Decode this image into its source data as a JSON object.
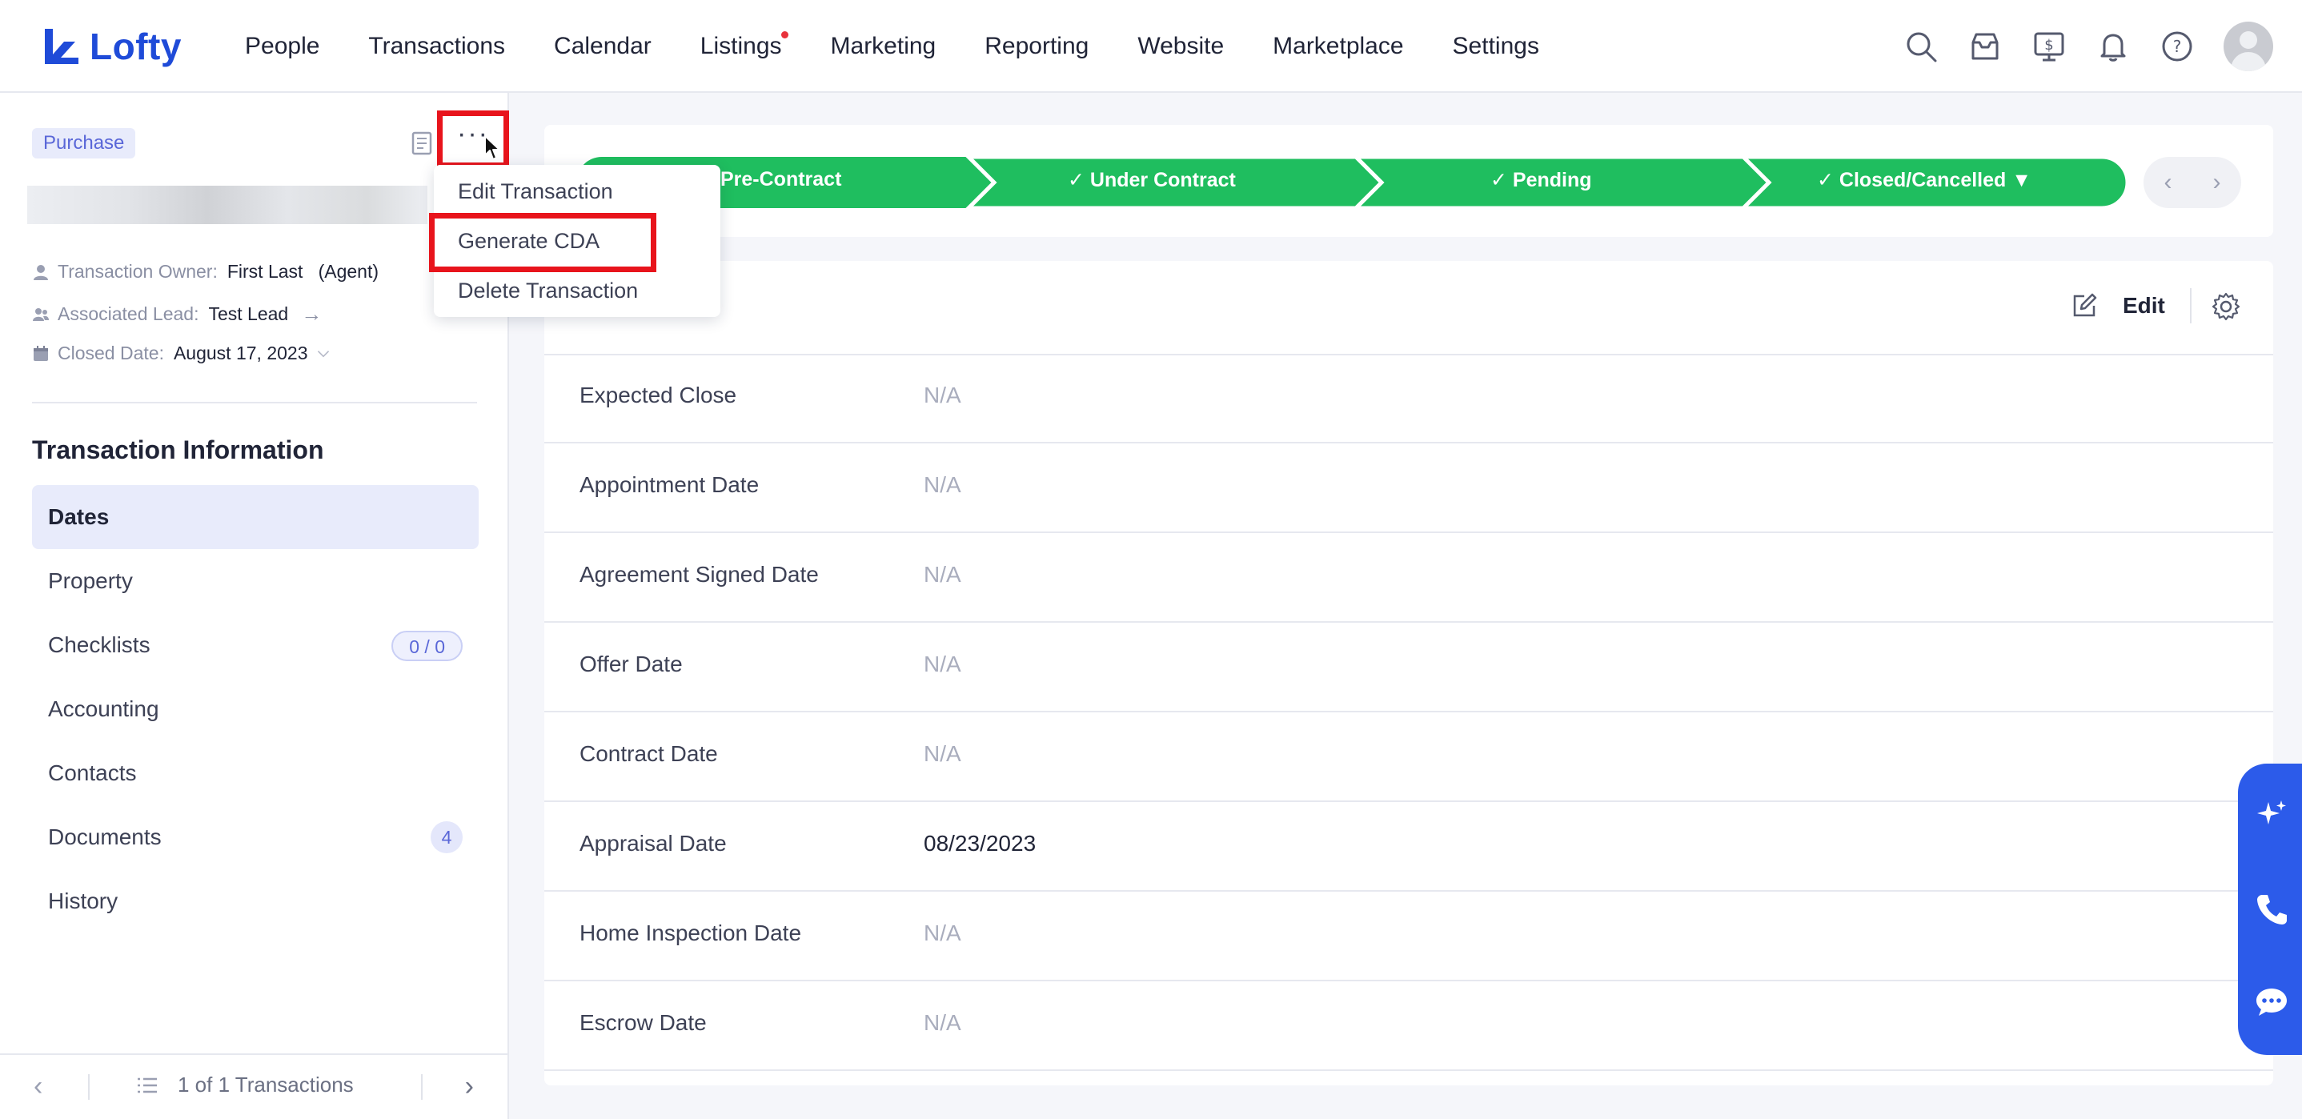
{
  "app": {
    "name": "Lofty"
  },
  "nav": {
    "items": [
      "People",
      "Transactions",
      "Calendar",
      "Listings",
      "Marketing",
      "Reporting",
      "Website",
      "Marketplace",
      "Settings"
    ]
  },
  "sidebar": {
    "badge": "Purchase",
    "more_label": "···",
    "meta": {
      "owner_label": "Transaction Owner:",
      "owner_value": "First Last   (Agent)",
      "lead_label": "Associated Lead:",
      "lead_value": "Test Lead",
      "closed_label": "Closed Date:",
      "closed_value": "August 17, 2023"
    },
    "section_title": "Transaction Information",
    "items": [
      {
        "label": "Dates"
      },
      {
        "label": "Property"
      },
      {
        "label": "Checklists",
        "count": "0 / 0"
      },
      {
        "label": "Accounting"
      },
      {
        "label": "Contacts"
      },
      {
        "label": "Documents",
        "count": "4"
      },
      {
        "label": "History"
      }
    ],
    "footer": {
      "pagination": "1 of 1 Transactions"
    }
  },
  "dropdown": {
    "items": [
      "Edit Transaction",
      "Generate CDA",
      "Delete Transaction"
    ]
  },
  "stages": [
    {
      "label": "Pre-Contract"
    },
    {
      "label": "Under Contract"
    },
    {
      "label": "Pending"
    },
    {
      "label": "Closed/Cancelled"
    }
  ],
  "dates_card": {
    "edit_label": "Edit",
    "rows": [
      {
        "label": "Expected Close",
        "value": "N/A"
      },
      {
        "label": "Appointment Date",
        "value": "N/A"
      },
      {
        "label": "Agreement Signed Date",
        "value": "N/A"
      },
      {
        "label": "Offer Date",
        "value": "N/A"
      },
      {
        "label": "Contract Date",
        "value": "N/A"
      },
      {
        "label": "Appraisal Date",
        "value": "08/23/2023"
      },
      {
        "label": "Home Inspection Date",
        "value": "N/A"
      },
      {
        "label": "Escrow Date",
        "value": "N/A"
      }
    ]
  },
  "colors": {
    "brand": "#1f4bd8",
    "stage_green": "#1fbe5f",
    "highlight_red": "#e8141c",
    "fab_blue": "#2c5bea"
  }
}
